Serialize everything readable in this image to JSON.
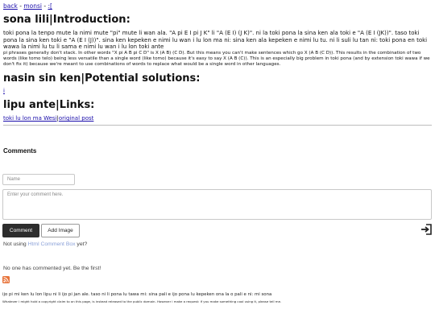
{
  "nav": {
    "links": [
      {
        "label": "back",
        "separator": " - "
      },
      {
        "label": "monsi",
        "separator": " - "
      },
      {
        "label": ":[",
        "separator": ""
      }
    ]
  },
  "sections": {
    "intro": {
      "heading": "sona lili|Introduction:",
      "body_tp": "toki pona la tenpo mute la nimi mute \"pi\" mute li wan ala. \"A pi E I pi J K\" li \"A (E I) (J K)\". ni la toki pona la sina ken ala toki e \"A (E I (JK))\". taso toki pona la sina ken toki e \"A (E I (J))\". sina ken kepeken e nimi lu wan i lu lon ma ni: sina ken ala kepeken e nimi lu tu. ni li suli lu tan ni: toki pona en toki wawa la nimi lu tu li sama e nimi lu wan i lu lon toki ante",
      "body_en": "pi phrases generally don't stack. In other words \"X pi A B pi C D\" is X (A B) (C D). But this means you can't make sentences which go X (A B (C D)). This results in the combination of two words (like tomo telo) being less versatile than a single word (like tomo) because it's easy to say X (A B (C)). This is an especially big problem in toki pona (and by extension toki wawa if we don't fix it) because we're meant to use combinations of words to replace what would be a single word in other languages."
    },
    "solutions": {
      "heading": "nasin sin ken|Potential solutions:",
      "link": "i"
    },
    "links": {
      "heading": "lipu ante|Links:",
      "link_a": "toki lu lon ma Wesi",
      "link_sep": "|",
      "link_b": "original post"
    }
  },
  "comments": {
    "title": "Comments",
    "name_placeholder": "Name",
    "comment_placeholder": "Enter your comment here.",
    "comment_button": "Comment",
    "add_image_button": "Add Image",
    "using_prefix": "Not using ",
    "using_link": "Html Comment Box",
    "using_suffix": "  yet?",
    "none_text": "No one has commented yet. Be the first!"
  },
  "footer": {
    "line1": "ijo pi mi ken lu lon lipu ni li ijo pi jan ale. taso ni li pona lu tawa mi: sina pali e ijo pona lu kepeken ona la o pali e ni: mi sona",
    "line2": "Whatever i might hold a copyright claim to on this page, is instead released to the public domain. However i make a request: if you make something cool using it, please tell me."
  },
  "colors": {
    "link": "#1a0dab",
    "comment_button_bg": "#2d2d2d",
    "rss_orange": "#e8743b",
    "comment_box_brand": "#8aa0d8"
  },
  "icons": {
    "login": "login-arrow-icon",
    "rss": "rss-feed-icon"
  }
}
